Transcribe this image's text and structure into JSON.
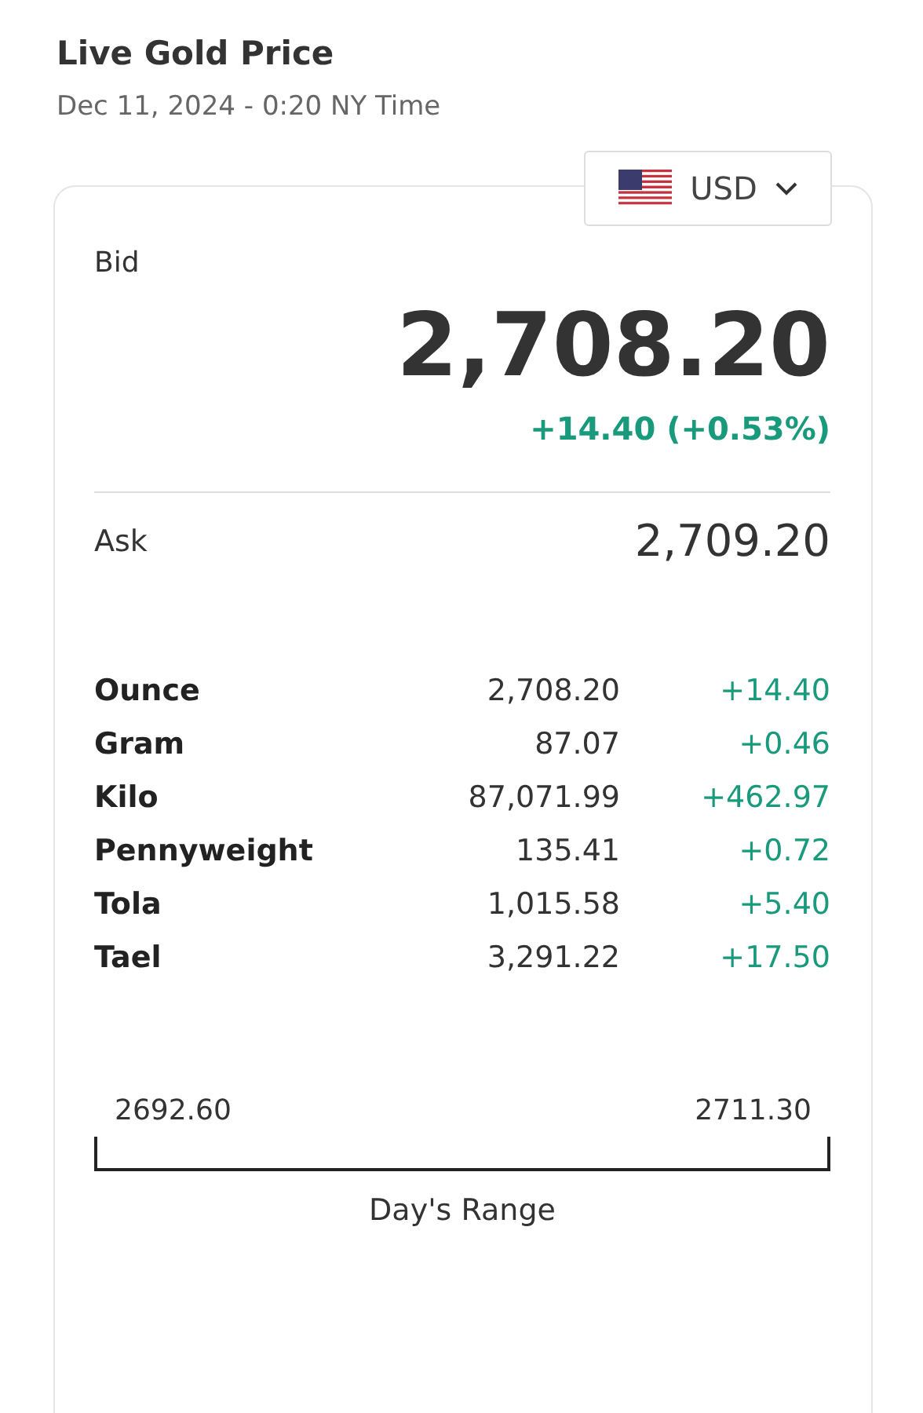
{
  "header": {
    "title": "Live Gold Price",
    "subtitle": "Dec 11, 2024 - 0:20 NY Time"
  },
  "currency": {
    "label": "USD"
  },
  "bid": {
    "label": "Bid",
    "price": "2,708.20",
    "change": "+14.40 (+0.53%)"
  },
  "ask": {
    "label": "Ask",
    "price": "2,709.20"
  },
  "units": [
    {
      "name": "Ounce",
      "price": "2,708.20",
      "change": "+14.40"
    },
    {
      "name": "Gram",
      "price": "87.07",
      "change": "+0.46"
    },
    {
      "name": "Kilo",
      "price": "87,071.99",
      "change": "+462.97"
    },
    {
      "name": "Pennyweight",
      "price": "135.41",
      "change": "+0.72"
    },
    {
      "name": "Tola",
      "price": "1,015.58",
      "change": "+5.40"
    },
    {
      "name": "Tael",
      "price": "3,291.22",
      "change": "+17.50"
    }
  ],
  "range": {
    "low": "2692.60",
    "high": "2711.30",
    "label": "Day's Range"
  }
}
